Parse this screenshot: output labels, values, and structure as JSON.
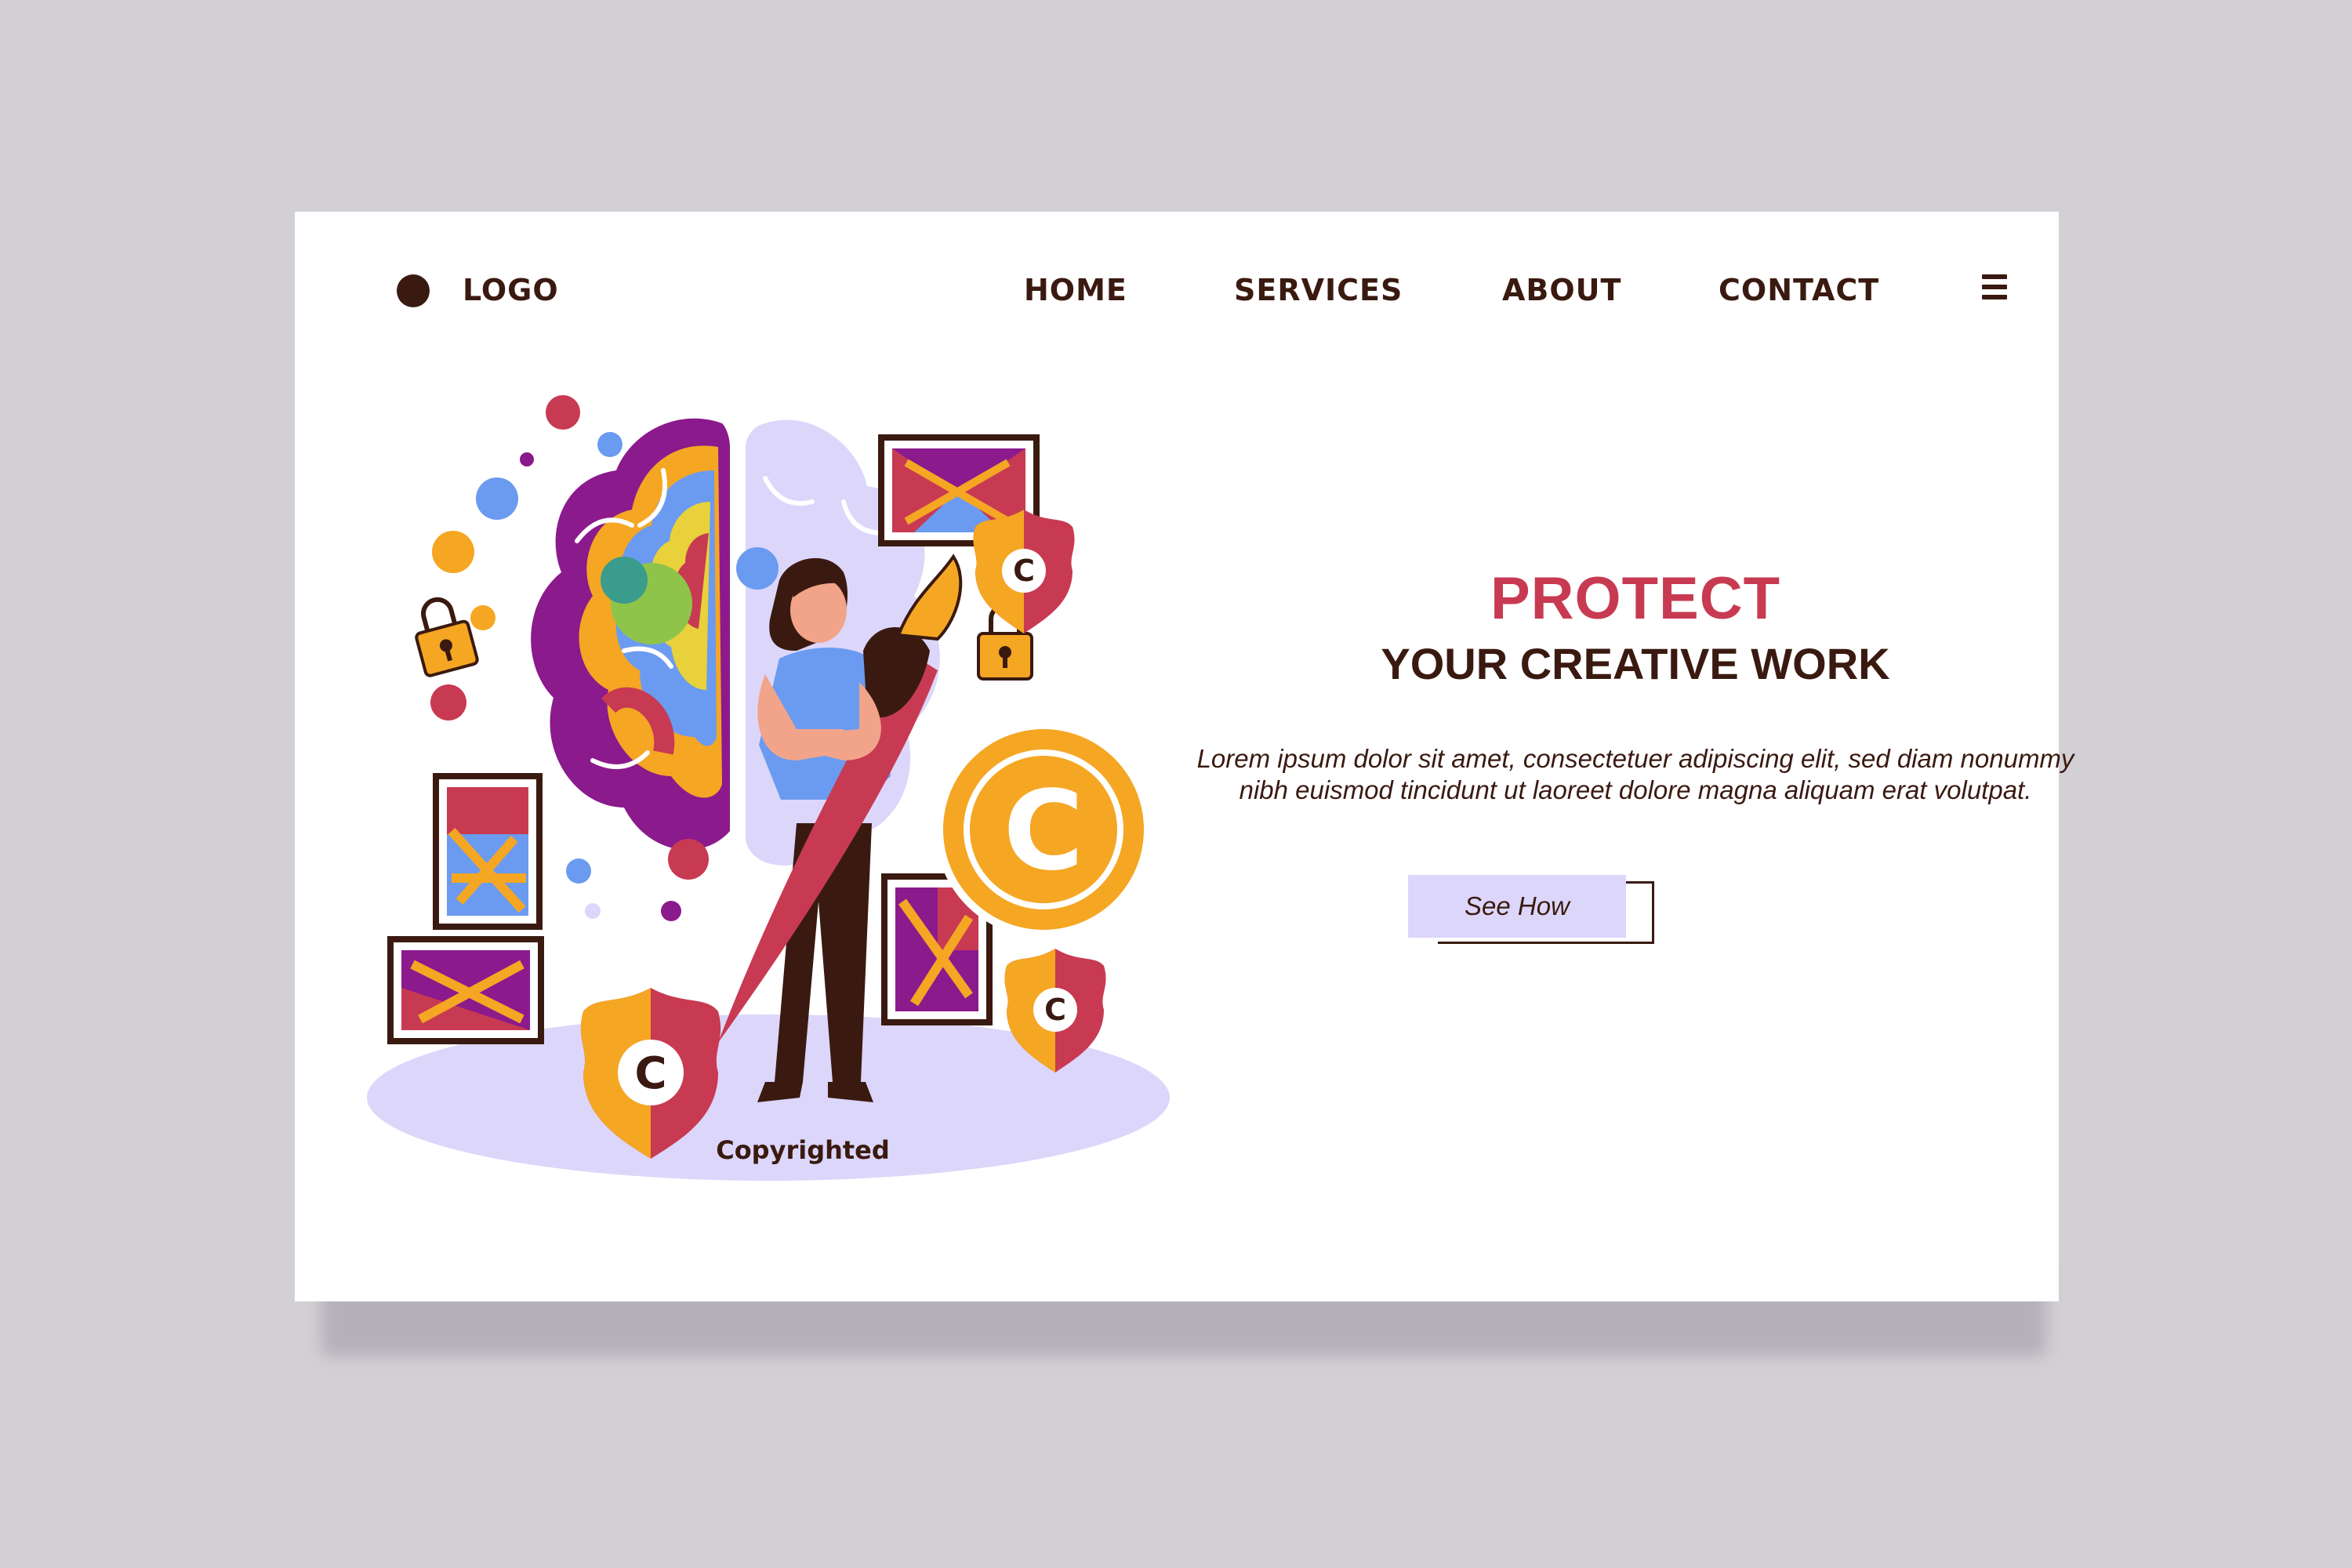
{
  "header": {
    "logo_label": "LOGO",
    "nav": [
      "HOME",
      "SERVICES",
      "ABOUT",
      "CONTACT"
    ]
  },
  "hero": {
    "title": "PROTECT",
    "subtitle": "YOUR CREATIVE WORK",
    "body": "Lorem ipsum dolor sit amet, consectetuer adipiscing elit, sed diam nonummy nibh euismod tincidunt ut laoreet dolore magna aliquam erat volutpat.",
    "cta_label": "See How"
  },
  "illustration": {
    "caption": "Copyrighted",
    "badge_letter": "C"
  },
  "colors": {
    "background": "#d3d0d5",
    "accent": "#c83a52",
    "dark": "#3a1a10",
    "lavender": "#dcd6fb",
    "orange": "#f5a623"
  }
}
